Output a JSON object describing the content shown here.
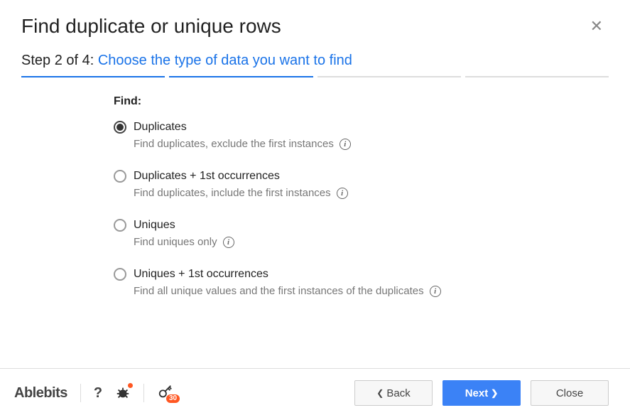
{
  "header": {
    "title": "Find duplicate or unique rows"
  },
  "subheader": {
    "step_prefix": "Step 2 of 4:",
    "step_suffix": "Choose the type of data you want to find"
  },
  "progress": {
    "total": 4,
    "current": 2
  },
  "content": {
    "find_label": "Find:",
    "options": [
      {
        "label": "Duplicates",
        "desc": "Find duplicates, exclude the first instances",
        "selected": true
      },
      {
        "label": "Duplicates + 1st occurrences",
        "desc": "Find duplicates, include the first instances",
        "selected": false
      },
      {
        "label": "Uniques",
        "desc": "Find uniques only",
        "selected": false
      },
      {
        "label": "Uniques + 1st occurrences",
        "desc": "Find all unique values and the first instances of the duplicates",
        "selected": false
      }
    ]
  },
  "footer": {
    "brand": "Ablebits",
    "license_badge": "30",
    "buttons": {
      "back": "Back",
      "next": "Next",
      "close": "Close"
    }
  }
}
